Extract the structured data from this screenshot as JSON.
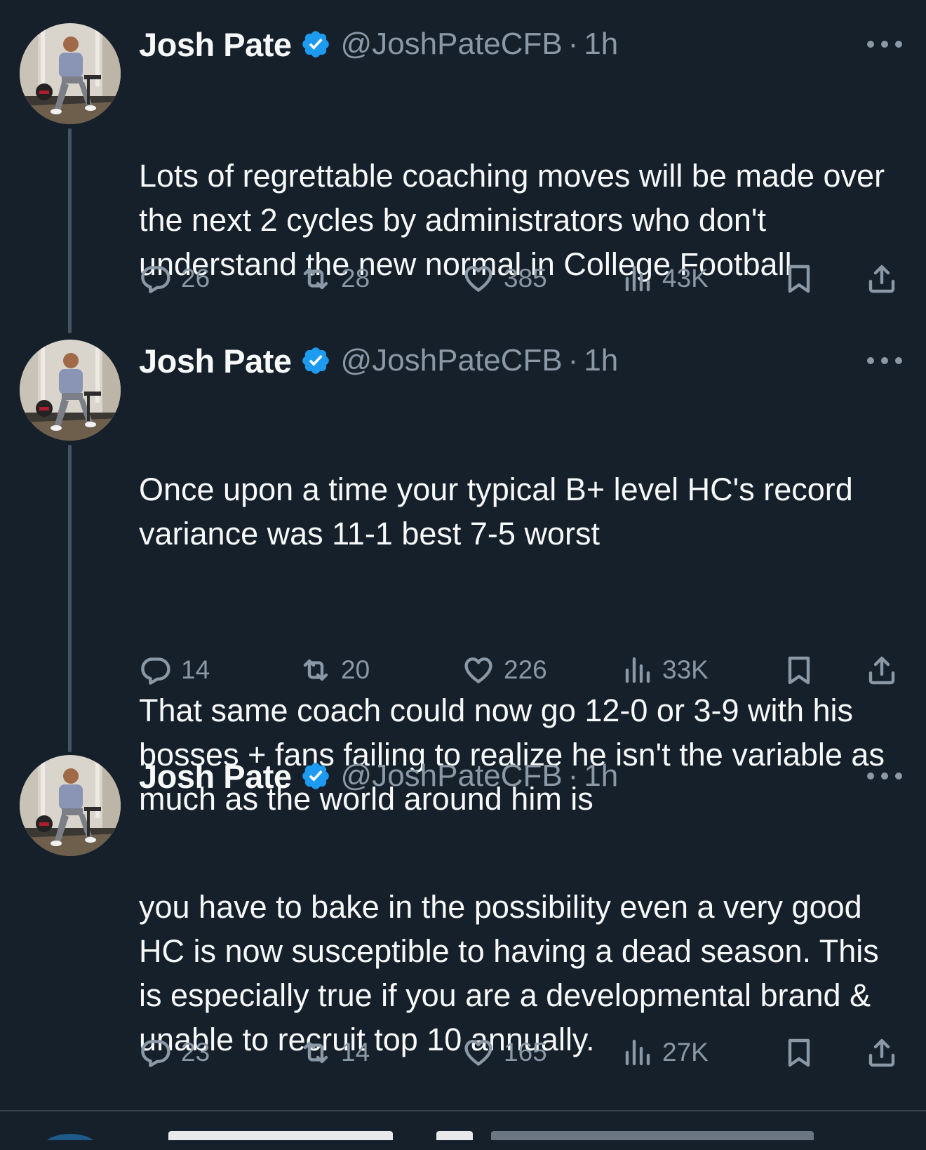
{
  "author": {
    "name": "Josh Pate",
    "handle": "@JoshPateCFB",
    "separator": "·"
  },
  "colors": {
    "background": "#15202b",
    "verified": "#1d9bf0",
    "muted": "#8b98a5"
  },
  "tweets": [
    {
      "time": "1h",
      "paragraphs": [
        "Lots of regrettable coaching moves will be made over the next 2 cycles by administrators who don't understand the new normal in College Football"
      ],
      "replies": "26",
      "retweets": "28",
      "likes": "385",
      "views": "43K"
    },
    {
      "time": "1h",
      "paragraphs": [
        "Once upon a time your typical B+ level HC's record variance was 11-1 best 7-5 worst",
        "That same coach could now go 12-0 or 3-9 with his bosses + fans failing to realize he isn't the variable as much as the world around him is"
      ],
      "replies": "14",
      "retweets": "20",
      "likes": "226",
      "views": "33K"
    },
    {
      "time": "1h",
      "paragraphs": [
        "you have to bake in the possibility even a very good HC is now susceptible to having a dead season. This is especially true if you are a developmental brand & unable to recruit top 10 annually."
      ],
      "replies": "23",
      "retweets": "14",
      "likes": "165",
      "views": "27K"
    }
  ],
  "icons": {
    "verified": "verified-badge-icon",
    "more": "more-dots-icon",
    "reply": "reply-bubble-icon",
    "retweet": "retweet-icon",
    "like": "heart-icon",
    "views": "views-chart-icon",
    "bookmark": "bookmark-icon",
    "share": "share-upload-icon"
  }
}
